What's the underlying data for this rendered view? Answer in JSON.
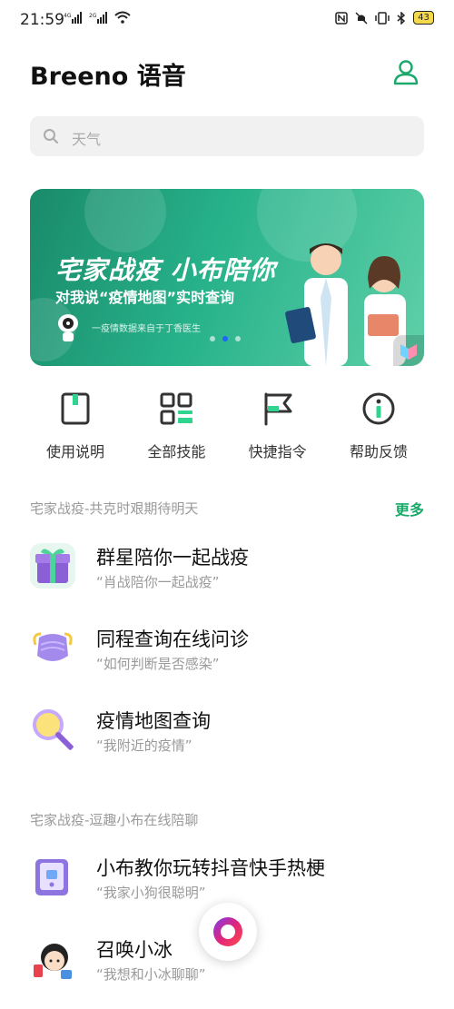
{
  "status_bar": {
    "time": "21:59",
    "signal_1": "4G",
    "signal_2": "2G",
    "battery": "43"
  },
  "header": {
    "title": "Breeno 语音",
    "profile_icon": "user-icon"
  },
  "search": {
    "placeholder": "天气"
  },
  "banner": {
    "title": "宅家战疫 小布陪你",
    "subtitle": "对我说“疫情地图”实时查询",
    "source": "一疫情数据来自于丁香医生",
    "dot_count": 3,
    "active_dot": 2
  },
  "quick_nav": [
    {
      "label": "使用说明",
      "icon": "instructions-icon"
    },
    {
      "label": "全部技能",
      "icon": "grid-icon"
    },
    {
      "label": "快捷指令",
      "icon": "flag-icon"
    },
    {
      "label": "帮助反馈",
      "icon": "info-icon"
    }
  ],
  "section1": {
    "title": "宅家战疫-共克时艰期待明天",
    "more": "更多",
    "items": [
      {
        "title": "群星陪你一起战疫",
        "subtitle": "“肖战陪你一起战疫”"
      },
      {
        "title": "同程查询在线问诊",
        "subtitle": "“如何判断是否感染”"
      },
      {
        "title": "疫情地图查询",
        "subtitle": "“我附近的疫情”"
      }
    ]
  },
  "section2": {
    "title": "宅家战疫-逗趣小布在线陪聊",
    "items": [
      {
        "title": "小布教你玩转抖音快手热梗",
        "subtitle": "“我家小狗很聪明”"
      },
      {
        "title": "召唤小冰",
        "subtitle": "“我想和小冰聊聊”"
      }
    ]
  },
  "colors": {
    "accent": "#1aa96a",
    "banner": "#27b28a"
  }
}
